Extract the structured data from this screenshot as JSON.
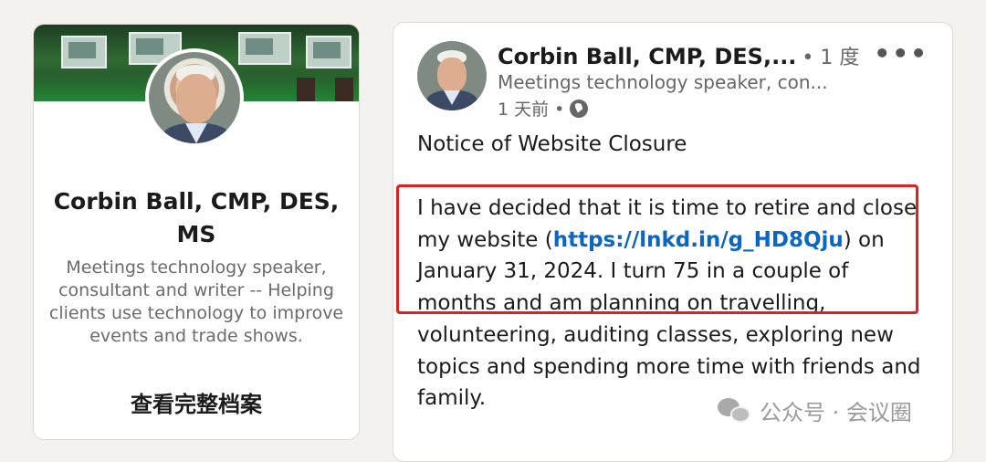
{
  "profile_card": {
    "name": "Corbin Ball, CMP, DES, MS",
    "headline": "Meetings technology speaker, consultant and writer -- Helping clients use technology to improve events and trade shows.",
    "view_profile_label": "查看完整档案"
  },
  "post": {
    "author_name": "Corbin Ball, CMP, DES,...",
    "connection_degree": "• 1 度",
    "author_headline": "Meetings technology speaker, con...",
    "timestamp": "1 天前 •",
    "visibility_icon": "globe-icon",
    "more_icon": "more-options-icon",
    "title": "Notice of Website Closure",
    "body_before_link": "I have decided that it is time to retire and close my website (",
    "link_text": "https://lnkd.in/g_HD8Qju",
    "body_after_link": ") on January 31, 2024. I turn 75 in a couple of months and am planning on travelling, volunteering, auditing classes, exploring new topics and spending more time with friends and family."
  },
  "watermark": {
    "text": "公众号 · 会议圈",
    "icon": "wechat-icon"
  },
  "colors": {
    "link": "#0a66c2",
    "highlight_box": "#e21e1e",
    "page_bg": "#f4f2ee"
  }
}
